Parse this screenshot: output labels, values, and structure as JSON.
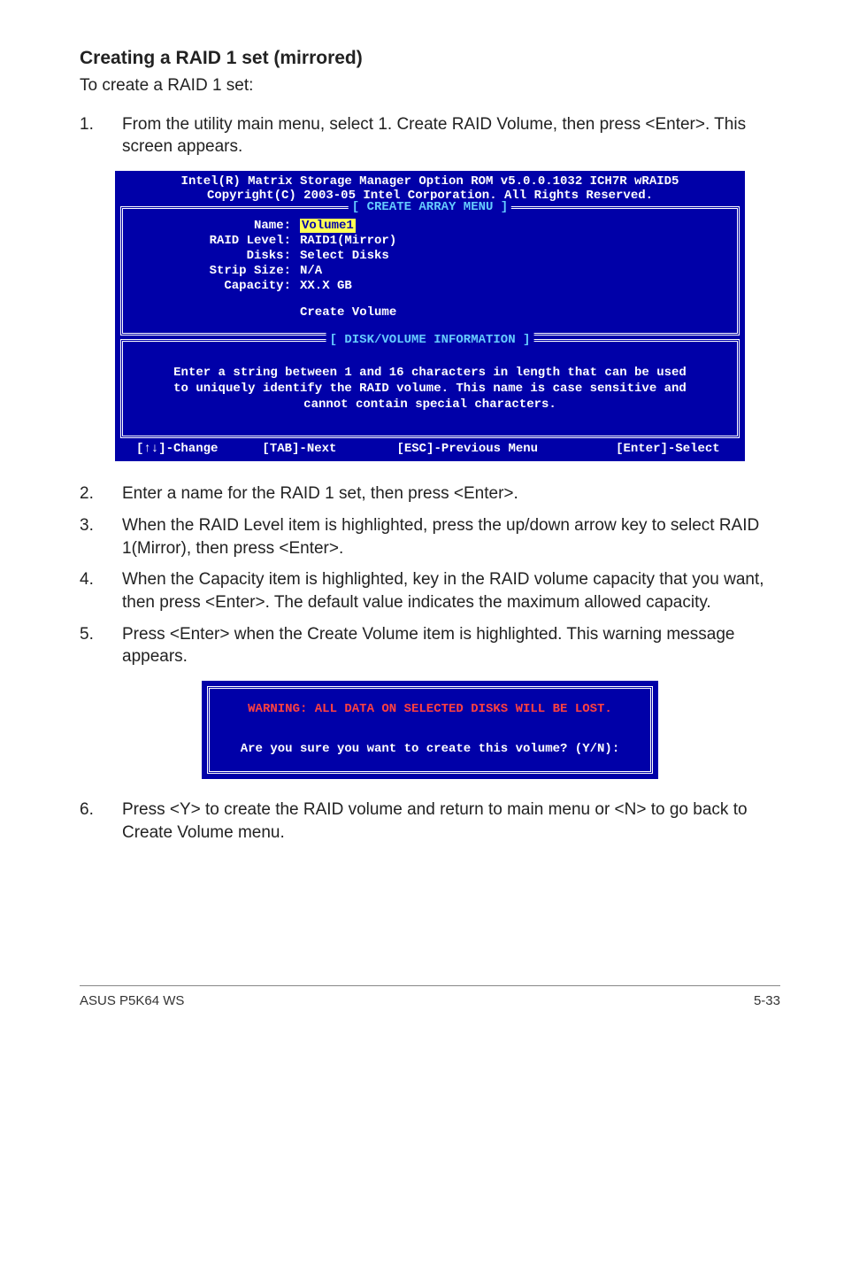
{
  "heading": "Creating a RAID 1 set (mirrored)",
  "intro": "To create a RAID 1 set:",
  "step1": {
    "num": "1.",
    "text": "From the utility main menu, select 1. Create RAID Volume, then press <Enter>. This screen appears."
  },
  "bios": {
    "title1": "Intel(R) Matrix Storage Manager Option ROM v5.0.0.1032 ICH7R wRAID5",
    "title2": "Copyright(C) 2003-05 Intel Corporation. All Rights Reserved.",
    "create_label": "[ CREATE ARRAY MENU ]",
    "fields": {
      "name_label": "Name:",
      "name_value": "Volume1",
      "raid_label": "RAID Level:",
      "raid_value": "RAID1(Mirror)",
      "disks_label": "Disks:",
      "disks_value": "Select Disks",
      "strip_label": "Strip Size:",
      "strip_value": "N/A",
      "cap_label": "Capacity:",
      "cap_value": "XX.X  GB",
      "create_volume": "Create Volume"
    },
    "disk_label": "[ DISK/VOLUME INFORMATION ]",
    "help1": "Enter a string between 1 and 16 characters in length that can be used",
    "help2": "to uniquely identify the RAID volume. This name is case sensitive and",
    "help3": "cannot contain special characters.",
    "status": {
      "change": "[↑↓]-Change",
      "next": "[TAB]-Next",
      "prev": "[ESC]-Previous Menu",
      "select": "[Enter]-Select"
    }
  },
  "step2": {
    "num": "2.",
    "text": "Enter a name for the RAID 1 set, then press <Enter>."
  },
  "step3": {
    "num": "3.",
    "text": "When the RAID Level item is highlighted, press the up/down arrow key to select RAID 1(Mirror), then press <Enter>."
  },
  "step4": {
    "num": "4.",
    "text": "When the Capacity item is highlighted, key in the RAID volume capacity that you want, then press <Enter>. The default value indicates the maximum allowed capacity."
  },
  "step5": {
    "num": "5.",
    "text": "Press <Enter> when the Create Volume item is highlighted. This warning message appears."
  },
  "warning": {
    "line1": "WARNING: ALL DATA ON SELECTED DISKS WILL BE LOST.",
    "line2": "Are you sure you want to create this volume? (Y/N):"
  },
  "step6": {
    "num": "6.",
    "text": "Press <Y> to create the RAID volume and return to main menu or <N> to go back to Create Volume menu."
  },
  "footer": {
    "left": "ASUS P5K64 WS",
    "right": "5-33"
  }
}
